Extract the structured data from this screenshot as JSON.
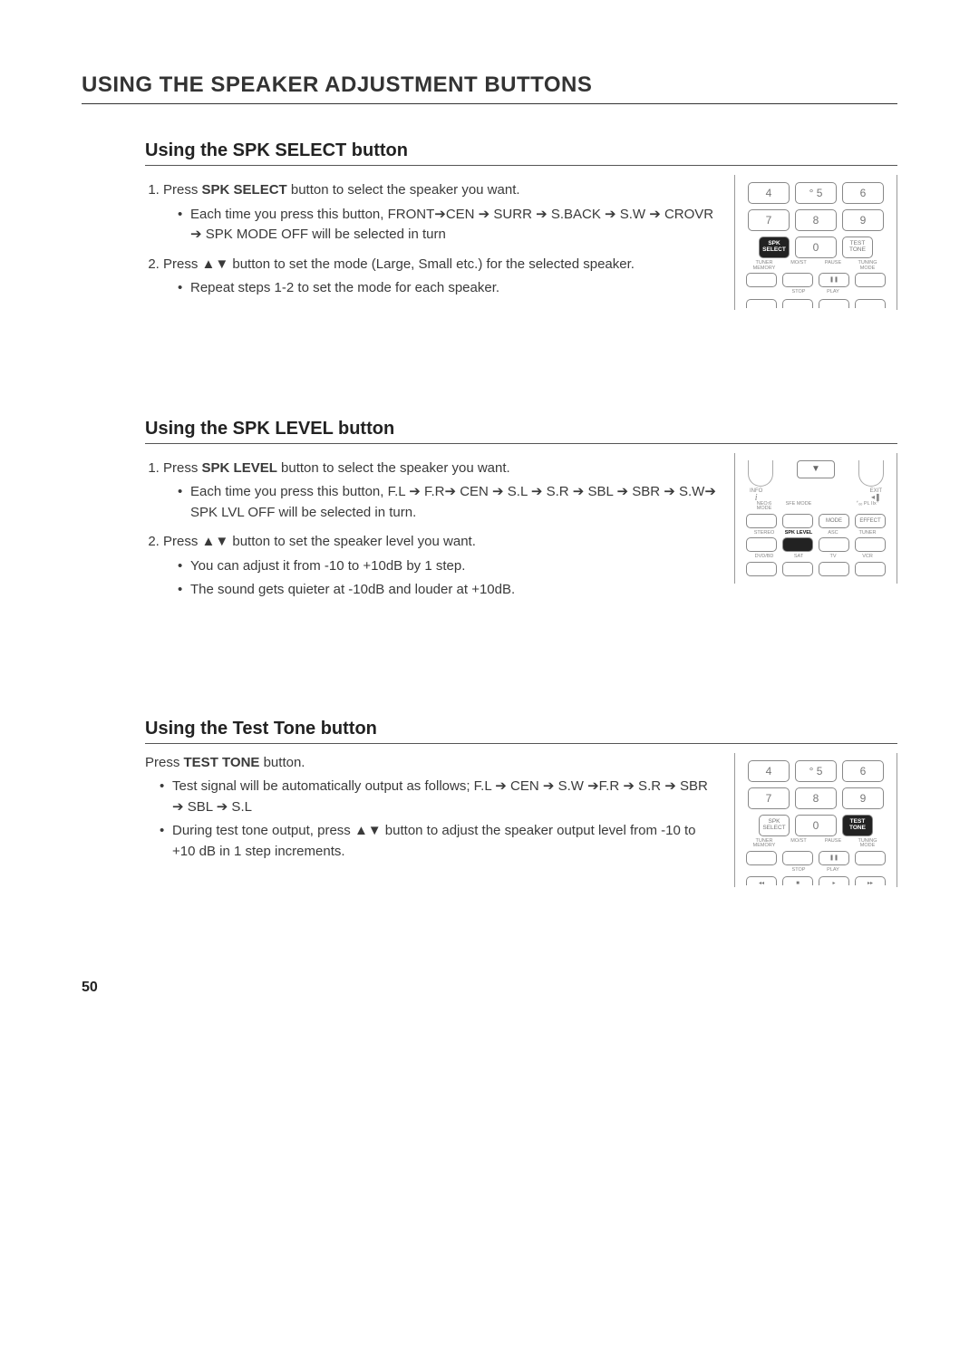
{
  "section_title": "USING THE SPEAKER ADJUSTMENT BUTTONS",
  "page_number": "50",
  "spk_select": {
    "title": "Using the SPK SELECT button",
    "step1_prefix": "Press ",
    "step1_bold": "SPK SELECT",
    "step1_suffix": " button to select the speaker you want.",
    "step1_bullet": "Each time you press this button,  FRONT➔CEN ➔ SURR ➔ S.BACK ➔ S.W ➔ CROVR ➔   SPK MODE OFF will be selected in turn",
    "step2": "Press ▲▼ button to set the mode (Large, Small etc.) for the selected speaker.",
    "step2_bullet": "Repeat steps 1-2 to set the mode for each speaker."
  },
  "spk_level": {
    "title": "Using the SPK LEVEL button",
    "step1_prefix": "Press ",
    "step1_bold": "SPK LEVEL",
    "step1_suffix": " button to select the speaker you want.",
    "step1_bullet": "Each time you press this button, F.L ➔ F.R➔ CEN ➔ S.L ➔ S.R ➔ SBL ➔ SBR ➔ S.W➔ SPK LVL OFF will be selected in turn.",
    "step2": "Press ▲▼ button to set the speaker level you want.",
    "step2_bullet1": "You can adjust it from -10 to +10dB by 1 step.",
    "step2_bullet2": "The sound gets quieter at -10dB and louder at +10dB."
  },
  "test_tone": {
    "title": "Using the Test Tone button",
    "line1_prefix": "Press ",
    "line1_bold": "TEST TONE",
    "line1_suffix": " button.",
    "bullet1": "Test signal will be automatically output as follows; F.L ➔ CEN ➔ S.W ➔F.R ➔ S.R ➔ SBR ➔ SBL ➔  S.L",
    "bullet2": "During test tone output, press ▲▼ button to adjust the speaker output level from -10 to +10 dB in 1 step increments."
  },
  "remote1": {
    "k4": "4",
    "k5": "° 5",
    "k6": "6",
    "k7": "7",
    "k8": "8",
    "k9": "9",
    "spk_select": "SPK\nSELECT",
    "k0": "0",
    "test_tone": "TEST\nTONE",
    "l_tuner": "TUNER MEMORY",
    "l_most": "MO/ST",
    "l_pause": "PAUSE",
    "l_tuning": "TUNING MODE",
    "pause_sym": "❚❚",
    "l_stop": "STOP",
    "l_play": "PLAY"
  },
  "remote2": {
    "down": "▼",
    "info_label": "INFO",
    "exit_label": "EXIT",
    "info_i": "i",
    "mute_sym": "◂❚",
    "l_neo": "NEO:6 MODE",
    "l_sfe": "SFE MODE",
    "l_pl": "⌜ₒₒ PL IIx⌝",
    "mode": "MODE",
    "effect": "EFFECT",
    "l_stereo": "STEREO",
    "l_spklvl": "SPK LEVEL",
    "l_asc": "ASC",
    "l_tuner": "TUNER",
    "l_dvd": "DVD/BD",
    "l_sat": "SAT",
    "l_tv": "TV",
    "l_vcr": "VCR"
  }
}
